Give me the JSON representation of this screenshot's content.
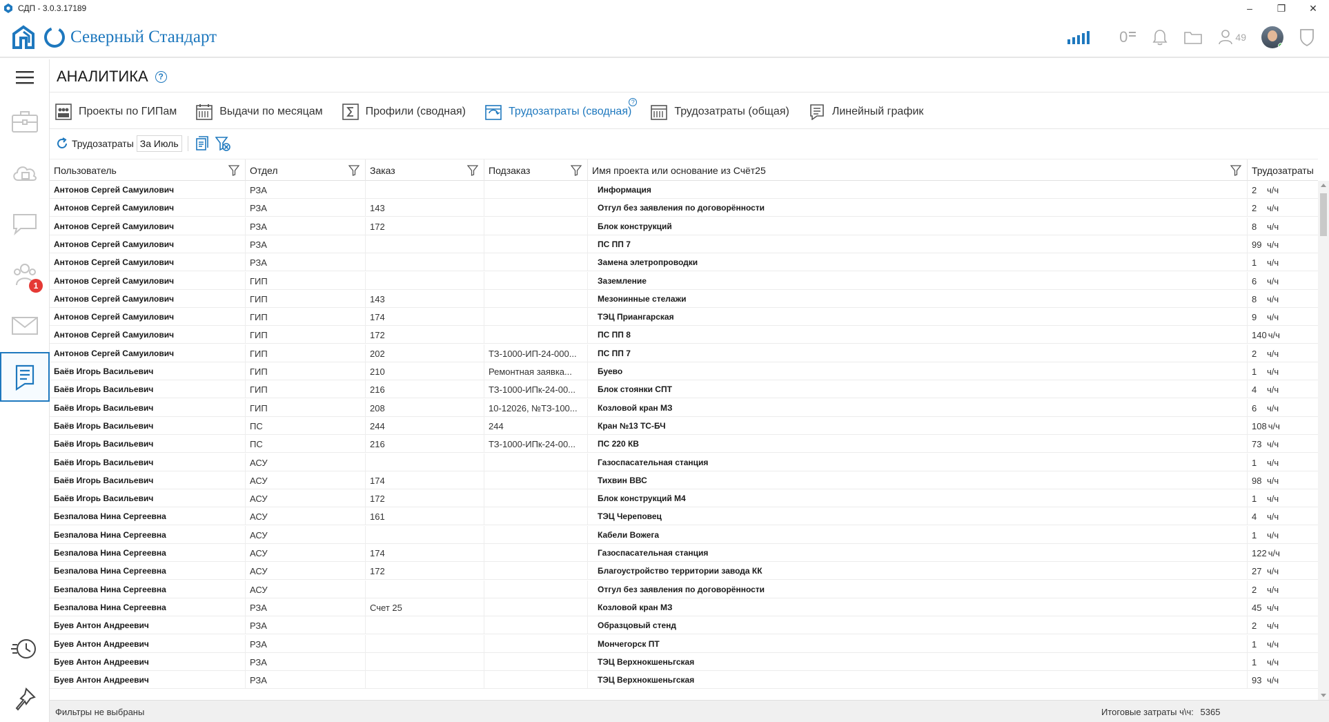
{
  "window": {
    "title": "СДП - 3.0.3.17189",
    "minimize": "–",
    "restore": "❐",
    "close": "✕"
  },
  "header": {
    "brand": "Северный Стандарт",
    "notifications_counter": "0",
    "users_count": "49",
    "accent_color": "#1e78be"
  },
  "sidebar": {
    "menu_icon": "hamburger-icon",
    "items": [
      {
        "name": "briefcase-icon"
      },
      {
        "name": "cloud-icon"
      },
      {
        "name": "chat-icon"
      },
      {
        "name": "team-icon",
        "badge": "1"
      },
      {
        "name": "mail-icon"
      },
      {
        "name": "analytics-icon",
        "active": true
      },
      {
        "name": "history-icon"
      },
      {
        "name": "pin-icon"
      }
    ]
  },
  "page": {
    "title": "АНАЛИТИКА",
    "help": "?"
  },
  "tabs": [
    {
      "label": "Проекты по ГИПам",
      "active": false
    },
    {
      "label": "Выдачи по месяцам",
      "active": false
    },
    {
      "label": "Профили (сводная)",
      "active": false
    },
    {
      "label": "Трудозатраты (сводная)",
      "active": true
    },
    {
      "label": "Трудозатраты (общая)",
      "active": false
    },
    {
      "label": "Линейный график",
      "active": false
    }
  ],
  "toolbar": {
    "refresh_label": "Трудозатраты",
    "period": "За Июль"
  },
  "table": {
    "columns": [
      "Пользователь",
      "Отдел",
      "Заказ",
      "Подзаказ",
      "Имя проекта или основание из Счёт25",
      "Трудозатраты"
    ],
    "unit": "ч/ч",
    "rows": [
      {
        "user": "Антонов Сергей Самуилович",
        "dept": "РЗА",
        "order": "",
        "sub": "",
        "project": "Информация",
        "hours": "2"
      },
      {
        "user": "Антонов Сергей Самуилович",
        "dept": "РЗА",
        "order": "143",
        "sub": "",
        "project": "Отгул без заявления по договорённости",
        "hours": "2"
      },
      {
        "user": "Антонов Сергей Самуилович",
        "dept": "РЗА",
        "order": "172",
        "sub": "",
        "project": "Блок конструкций",
        "hours": "8"
      },
      {
        "user": "Антонов Сергей Самуилович",
        "dept": "РЗА",
        "order": "",
        "sub": "",
        "project": "ПС ПП 7",
        "hours": "99"
      },
      {
        "user": "Антонов Сергей Самуилович",
        "dept": "РЗА",
        "order": "",
        "sub": "",
        "project": "Замена элетропроводки",
        "hours": "1"
      },
      {
        "user": "Антонов Сергей Самуилович",
        "dept": "ГИП",
        "order": "",
        "sub": "",
        "project": "Заземление",
        "hours": "6"
      },
      {
        "user": "Антонов Сергей Самуилович",
        "dept": "ГИП",
        "order": "143",
        "sub": "",
        "project": "Мезонинные стелажи",
        "hours": "8"
      },
      {
        "user": "Антонов Сергей Самуилович",
        "dept": "ГИП",
        "order": "174",
        "sub": "",
        "project": "ТЭЦ Приангарская",
        "hours": "9"
      },
      {
        "user": "Антонов Сергей Самуилович",
        "dept": "ГИП",
        "order": "172",
        "sub": "",
        "project": "ПС ПП 8",
        "hours": "140"
      },
      {
        "user": "Антонов Сергей Самуилович",
        "dept": "ГИП",
        "order": "202",
        "sub": "ТЗ-1000-ИП-24-000...",
        "project": "ПС ПП 7",
        "hours": "2"
      },
      {
        "user": "Баёв Игорь Васильевич",
        "dept": "ГИП",
        "order": "210",
        "sub": "Ремонтная заявка...",
        "project": "Буево",
        "hours": "1"
      },
      {
        "user": "Баёв Игорь Васильевич",
        "dept": "ГИП",
        "order": "216",
        "sub": "ТЗ-1000-ИПк-24-00...",
        "project": "Блок стоянки СПТ",
        "hours": "4"
      },
      {
        "user": "Баёв Игорь Васильевич",
        "dept": "ГИП",
        "order": "208",
        "sub": "10-12026, №ТЗ-100...",
        "project": "Козловой кран МЗ",
        "hours": "6"
      },
      {
        "user": "Баёв Игорь Васильевич",
        "dept": "ПС",
        "order": "244",
        "sub": "244",
        "project": "Кран №13 ТС-БЧ",
        "hours": "108"
      },
      {
        "user": "Баёв Игорь Васильевич",
        "dept": "ПС",
        "order": "216",
        "sub": "ТЗ-1000-ИПк-24-00...",
        "project": "ПС 220 КВ",
        "hours": "73"
      },
      {
        "user": "Баёв Игорь Васильевич",
        "dept": "АСУ",
        "order": "",
        "sub": "",
        "project": "Газоспасательная станция",
        "hours": "1"
      },
      {
        "user": "Баёв Игорь Васильевич",
        "dept": "АСУ",
        "order": "174",
        "sub": "",
        "project": "Тихвин ВВС",
        "hours": "98"
      },
      {
        "user": "Баёв Игорь Васильевич",
        "dept": "АСУ",
        "order": "172",
        "sub": "",
        "project": "Блок конструкций М4",
        "hours": "1"
      },
      {
        "user": "Безпалова Нина Сергеевна",
        "dept": "АСУ",
        "order": "161",
        "sub": "",
        "project": "ТЭЦ Череповец",
        "hours": "4"
      },
      {
        "user": "Безпалова Нина Сергеевна",
        "dept": "АСУ",
        "order": "",
        "sub": "",
        "project": "Кабели Вожега",
        "hours": "1"
      },
      {
        "user": "Безпалова Нина Сергеевна",
        "dept": "АСУ",
        "order": "174",
        "sub": "",
        "project": "Газоспасательная станция",
        "hours": "122"
      },
      {
        "user": "Безпалова Нина Сергеевна",
        "dept": "АСУ",
        "order": "172",
        "sub": "",
        "project": "Благоустройство территории завода КК",
        "hours": "27"
      },
      {
        "user": "Безпалова Нина Сергеевна",
        "dept": "АСУ",
        "order": "",
        "sub": "",
        "project": "Отгул без заявления по договорённости",
        "hours": "2"
      },
      {
        "user": "Безпалова Нина Сергеевна",
        "dept": "РЗА",
        "order": "Счет 25",
        "sub": "",
        "project": "Козловой кран МЗ",
        "hours": "45"
      },
      {
        "user": "Буев Антон Андреевич",
        "dept": "РЗА",
        "order": "",
        "sub": "",
        "project": "Образцовый стенд",
        "hours": "2"
      },
      {
        "user": "Буев Антон Андреевич",
        "dept": "РЗА",
        "order": "",
        "sub": "",
        "project": "Мончегорск ПТ",
        "hours": "1"
      },
      {
        "user": "Буев Антон Андреевич",
        "dept": "РЗА",
        "order": "",
        "sub": "",
        "project": "ТЭЦ Верхнокшеньгская",
        "hours": "1"
      },
      {
        "user": "Буев Антон Андреевич",
        "dept": "РЗА",
        "order": "",
        "sub": "",
        "project": "ТЭЦ Верхнокшеньгская",
        "hours": "93"
      }
    ]
  },
  "footer": {
    "filters_status": "Фильтры не выбраны",
    "total_label": "Итоговые затраты ч\\ч:",
    "total_value": "5365"
  }
}
